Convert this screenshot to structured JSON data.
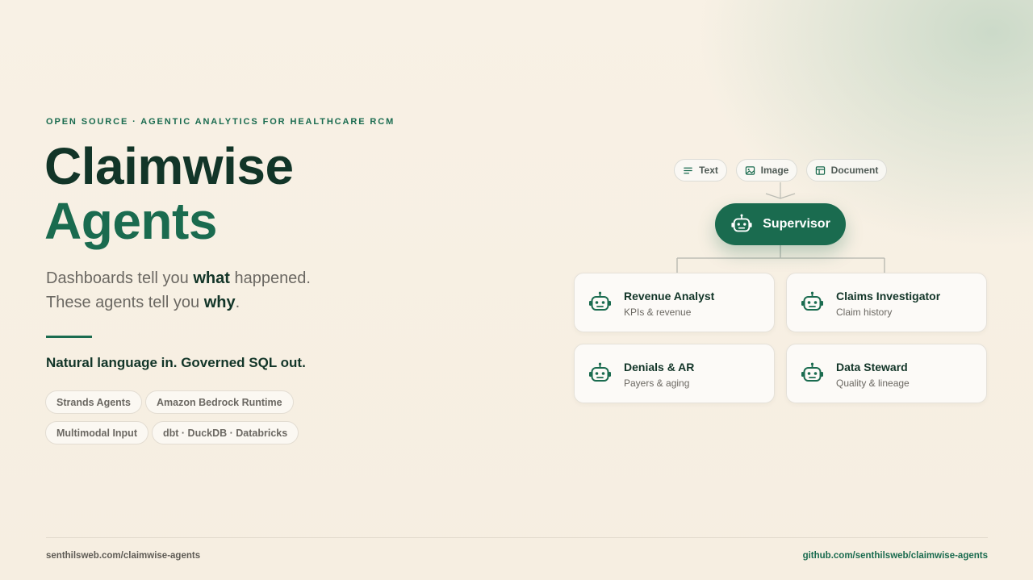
{
  "hero": {
    "eyebrow": "OPEN SOURCE · AGENTIC ANALYTICS FOR HEALTHCARE RCM",
    "title_line1": "Claimwise",
    "title_line2": "Agents",
    "tagline_line1": {
      "pre": "Dashboards tell you ",
      "bold": "what",
      "post": " happened."
    },
    "tagline_line2": {
      "pre": "These agents tell you ",
      "bold": "why",
      "post": "."
    },
    "subhead": "Natural language in. Governed SQL out.",
    "chips": [
      "Strands Agents",
      "Amazon Bedrock Runtime",
      "Multimodal Input",
      "dbt · DuckDB · Databricks"
    ]
  },
  "diagram": {
    "inputs": [
      {
        "label": "Text",
        "icon": "text-lines-icon"
      },
      {
        "label": "Image",
        "icon": "image-icon"
      },
      {
        "label": "Document",
        "icon": "document-icon"
      }
    ],
    "supervisor": {
      "label": "Supervisor",
      "icon": "robot-icon"
    },
    "agents": [
      {
        "name": "Revenue Analyst",
        "desc": "KPIs & revenue",
        "icon": "robot-icon"
      },
      {
        "name": "Claims Investigator",
        "desc": "Claim history",
        "icon": "robot-icon"
      },
      {
        "name": "Denials & AR",
        "desc": "Payers & aging",
        "icon": "robot-icon"
      },
      {
        "name": "Data Steward",
        "desc": "Quality & lineage",
        "icon": "robot-icon"
      }
    ]
  },
  "footer": {
    "left": "senthilsweb.com/claimwise-agents",
    "right": "github.com/senthilsweb/claimwise-agents"
  },
  "colors": {
    "accent": "#1a6b4f",
    "ink": "#123528",
    "muted": "#6b6862",
    "background": "#f7efe2"
  }
}
